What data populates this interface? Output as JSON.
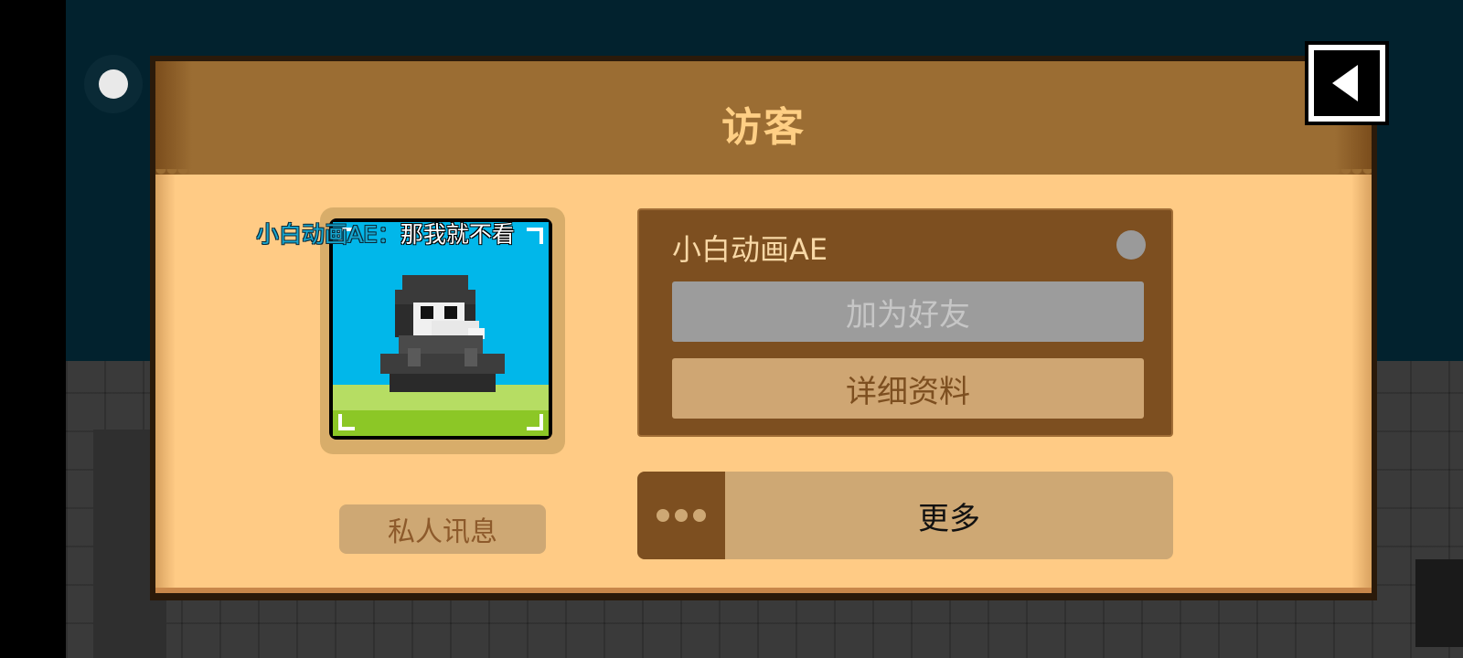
{
  "dialog": {
    "title": "访客"
  },
  "chat": {
    "name": "小白动画AE：",
    "message": "那我就不看"
  },
  "player": {
    "name": "小白动画AE",
    "online_status_color": "#9a9a9a",
    "avatar_icon": "plague-doctor-character"
  },
  "buttons": {
    "add_friend": "加为好友",
    "details": "详细资料",
    "private_message": "私人讯息",
    "more": "更多"
  },
  "icons": {
    "back": "back-arrow-icon",
    "more": "ellipsis-icon",
    "status": "status-dot-icon"
  },
  "colors": {
    "header": "#9b6d33",
    "body": "#ffcb85",
    "title": "#ffcf85",
    "panel": "#7d4f20",
    "button_tan": "#cea874",
    "disabled": "#9c9c9c",
    "avatar_sky": "#01b7ea"
  }
}
